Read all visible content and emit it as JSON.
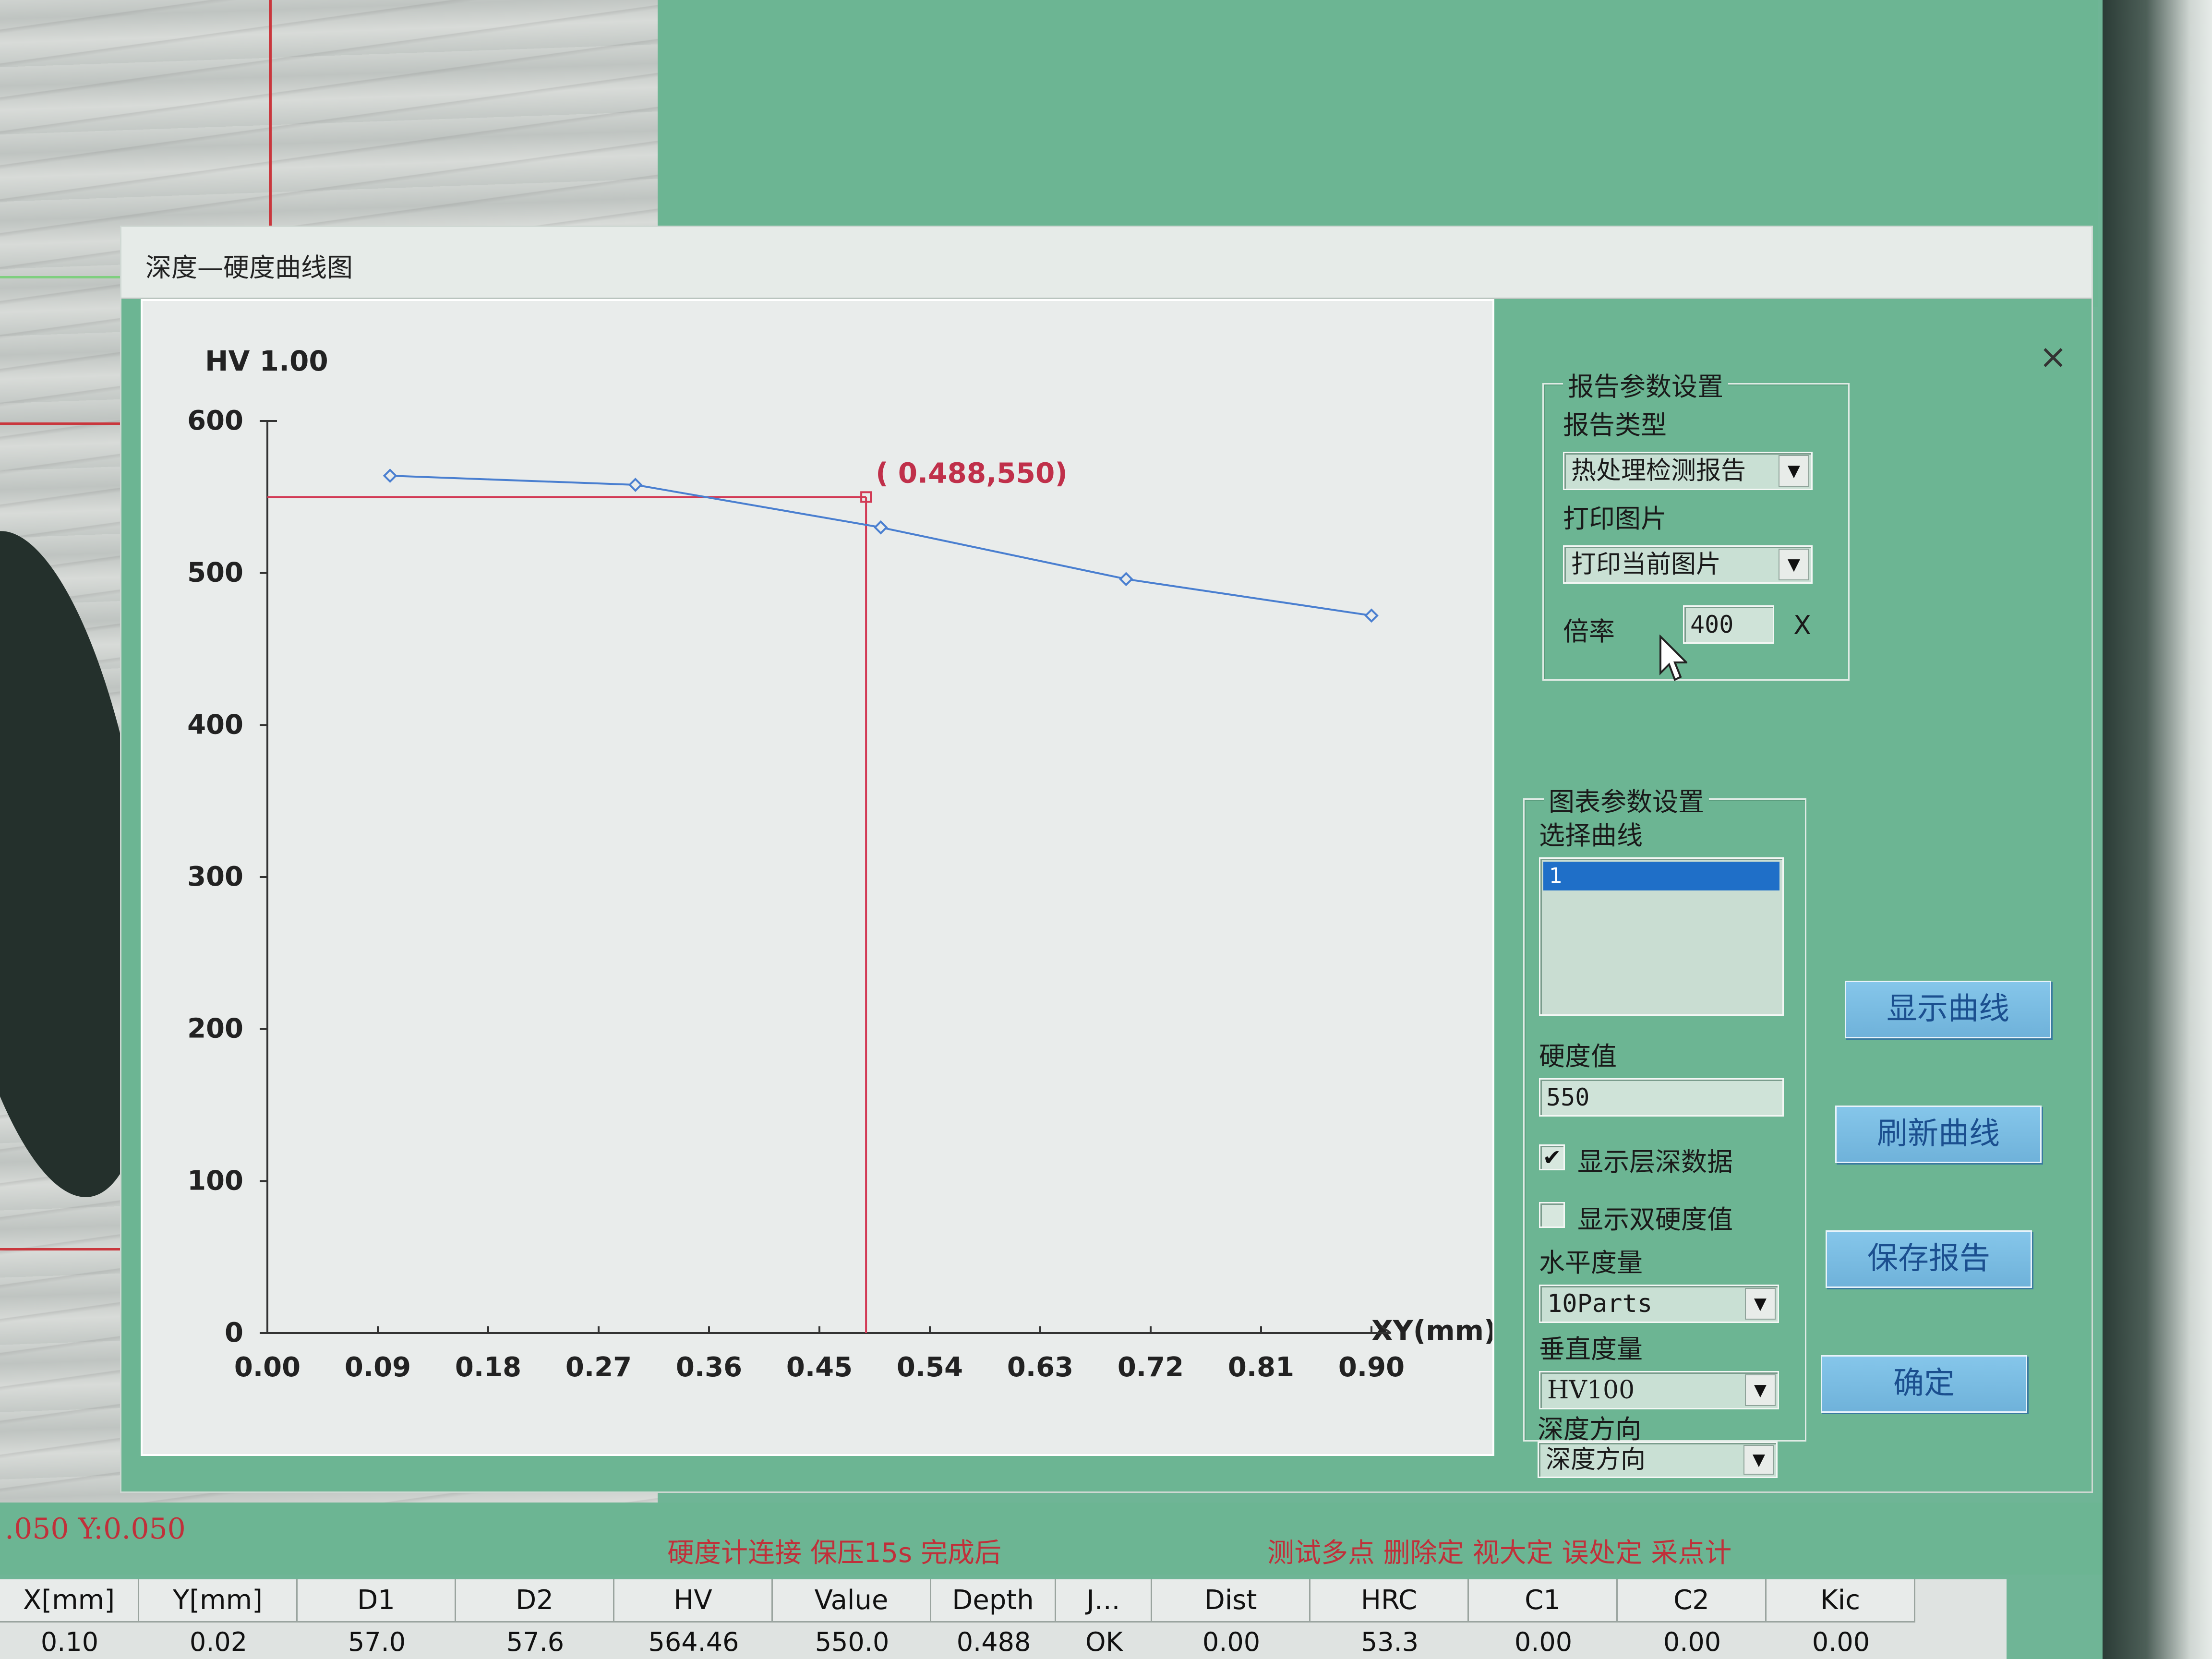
{
  "dialog": {
    "title": "深度—硬度曲线图",
    "close_label": "×"
  },
  "chart_data": {
    "type": "line",
    "title": "",
    "ylabel": "HV 1.00",
    "xlabel": "XY(mm)",
    "ylim": [
      0,
      600
    ],
    "xlim": [
      0.0,
      0.9
    ],
    "y_ticks": [
      "0",
      "100",
      "200",
      "300",
      "400",
      "500",
      "600"
    ],
    "x_ticks": [
      "0.00",
      "0.09",
      "0.18",
      "0.27",
      "0.36",
      "0.45",
      "0.54",
      "0.63",
      "0.72",
      "0.81",
      "0.90"
    ],
    "series": [
      {
        "x": [
          0.1,
          0.3,
          0.5,
          0.7,
          0.9
        ],
        "y": [
          564,
          558,
          530,
          496,
          472
        ],
        "color": "#4a7fd0"
      }
    ],
    "reference_y": 550,
    "intersection": {
      "x": 0.488,
      "y": 550,
      "label": "( 0.488,550)"
    },
    "reference_color": "#d23a55"
  },
  "report_settings": {
    "group_title": "报告参数设置",
    "report_type_label": "报告类型",
    "report_type_value": "热处理检测报告",
    "print_image_label": "打印图片",
    "print_image_value": "打印当前图片",
    "magnification_label": "倍率",
    "magnification_value": "400",
    "magnification_unit": "X"
  },
  "chart_settings": {
    "group_title": "图表参数设置",
    "select_curve_label": "选择曲线",
    "curve_items": [
      "1"
    ],
    "hardness_label": "硬度值",
    "hardness_value": "550",
    "show_depth_label": "显示层深数据",
    "show_depth_checked": "✔",
    "show_double_label": "显示双硬度值",
    "horizontal_label": "水平度量",
    "horizontal_value": "10Parts",
    "vertical_label": "垂直度量",
    "vertical_value": "HV100",
    "depth_dir_label": "深度方向",
    "depth_dir_value": "深度方向"
  },
  "buttons": {
    "show_curve": "显示曲线",
    "refresh_curve": "刷新曲线",
    "save_report": "保存报告",
    "ok": "确定"
  },
  "status": {
    "coords": ".050 Y:0.050",
    "msg1": "硬度计连接  保压15s  完成后",
    "msg2": "测试多点  删除定  视大定  误处定  采点计"
  },
  "table": {
    "headers": [
      "X[mm]",
      "Y[mm]",
      "D1",
      "D2",
      "HV",
      "Value",
      "Depth",
      "J...",
      "Dist",
      "HRC",
      "C1",
      "C2",
      "Kic"
    ],
    "row1": [
      "0.10",
      "0.02",
      "57.0",
      "57.6",
      "564.46",
      "550.0",
      "0.488",
      "OK",
      "0.00",
      "53.3",
      "0.00",
      "0.00",
      "0.00"
    ]
  },
  "icons": {
    "dropdown": "▼",
    "close": "close-icon",
    "cursor": "mouse-pointer-icon"
  }
}
